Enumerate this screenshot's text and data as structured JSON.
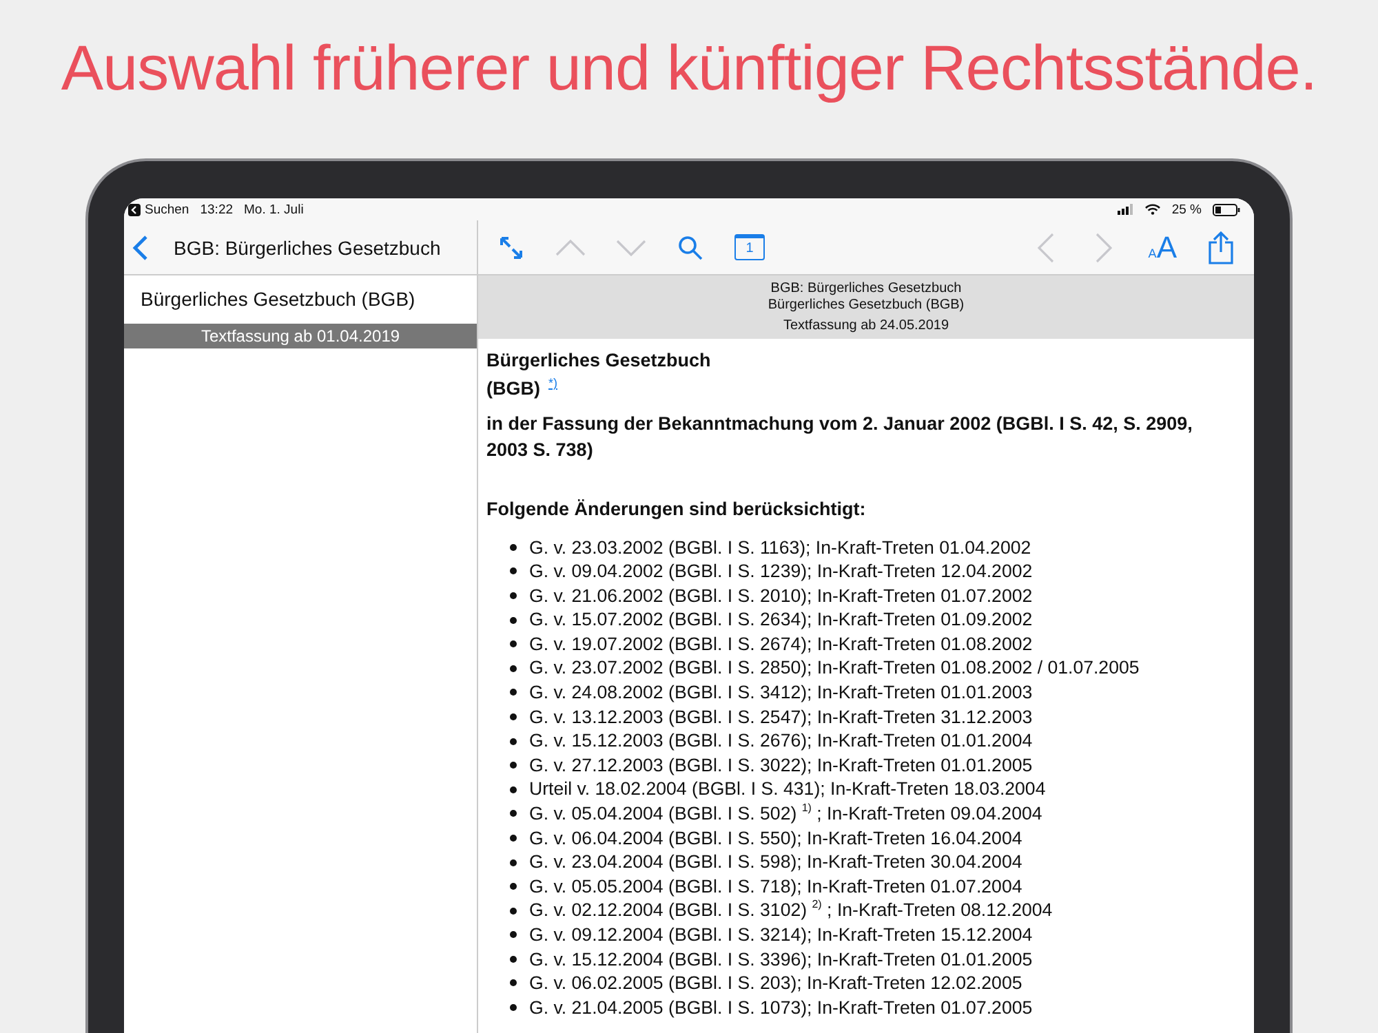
{
  "headline": "Auswahl früherer und künftiger Rechtsstände.",
  "status_bar": {
    "back_app": "Suchen",
    "time": "13:22",
    "date": "Mo. 1. Juli",
    "battery": "25 %"
  },
  "sidebar": {
    "title": "BGB: Bürgerliches Gesetzbuch",
    "items": [
      {
        "kind": "document",
        "label": "Bürgerliches Gesetzbuch (BGB)",
        "selected": false
      },
      {
        "kind": "version",
        "label": "Textfassung ab 01.04.2019",
        "selected": true
      }
    ]
  },
  "toolbar": {
    "left": [
      {
        "kind": "expand",
        "disabled": false
      },
      {
        "kind": "up",
        "disabled": true
      },
      {
        "kind": "down",
        "disabled": true
      },
      {
        "kind": "search",
        "disabled": false
      },
      {
        "kind": "calendar",
        "label": "1",
        "disabled": false
      }
    ],
    "right": [
      {
        "kind": "back",
        "disabled": true
      },
      {
        "kind": "forward",
        "disabled": true
      },
      {
        "kind": "font",
        "label_small": "A",
        "label_large": "A",
        "disabled": false
      },
      {
        "kind": "share",
        "disabled": false
      }
    ]
  },
  "document_header": {
    "lines": [
      "BGB: Bürgerliches Gesetzbuch",
      "Bürgerliches Gesetzbuch (BGB)"
    ],
    "version": "Textfassung ab 24.05.2019"
  },
  "document": {
    "title": "Bürgerliches Gesetzbuch",
    "abbreviation": "(BGB)",
    "footnote_link": "*)",
    "subtitle": "in der Fassung der Bekanntmachung vom 2. Januar 2002 (BGBl. I S. 42, S. 2909, 2003 S. 738)",
    "changes_heading": "Folgende Änderungen sind berücksichtigt:",
    "changes": [
      "G. v. 23.03.2002 (BGBl. I S. 1163); In-Kraft-Treten 01.04.2002",
      "G. v. 09.04.2002 (BGBl. I S. 1239); In-Kraft-Treten 12.04.2002",
      "G. v. 21.06.2002 (BGBl. I S. 2010); In-Kraft-Treten 01.07.2002",
      "G. v. 15.07.2002 (BGBl. I S. 2634); In-Kraft-Treten 01.09.2002",
      "G. v. 19.07.2002 (BGBl. I S. 2674); In-Kraft-Treten 01.08.2002",
      "G. v. 23.07.2002 (BGBl. I S. 2850); In-Kraft-Treten 01.08.2002 / 01.07.2005",
      "G. v. 24.08.2002 (BGBl. I S. 3412); In-Kraft-Treten 01.01.2003",
      "G. v. 13.12.2003 (BGBl. I S. 2547); In-Kraft-Treten 31.12.2003",
      "G. v. 15.12.2003 (BGBl. I S. 2676); In-Kraft-Treten 01.01.2004",
      "G. v. 27.12.2003 (BGBl. I S. 3022); In-Kraft-Treten 01.01.2005",
      "Urteil v. 18.02.2004 (BGBl. I S. 431); In-Kraft-Treten 18.03.2004",
      "G. v. 05.04.2004 (BGBl. I S. 502) $^{1)}$ ; In-Kraft-Treten 09.04.2004",
      "G. v. 06.04.2004 (BGBl. I S. 550); In-Kraft-Treten 16.04.2004",
      "G. v. 23.04.2004 (BGBl. I S. 598); In-Kraft-Treten 30.04.2004",
      "G. v. 05.05.2004 (BGBl. I S. 718); In-Kraft-Treten 01.07.2004",
      "G. v. 02.12.2004 (BGBl. I S. 3102) $^{2)}$ ; In-Kraft-Treten 08.12.2004",
      "G. v. 09.12.2004 (BGBl. I S. 3214); In-Kraft-Treten 15.12.2004",
      "G. v. 15.12.2004 (BGBl. I S. 3396); In-Kraft-Treten 01.01.2005",
      "G. v. 06.02.2005 (BGBl. I S. 203); In-Kraft-Treten 12.02.2005",
      "G. v. 21.04.2005 (BGBl. I S. 1073); In-Kraft-Treten 01.07.2005"
    ]
  }
}
